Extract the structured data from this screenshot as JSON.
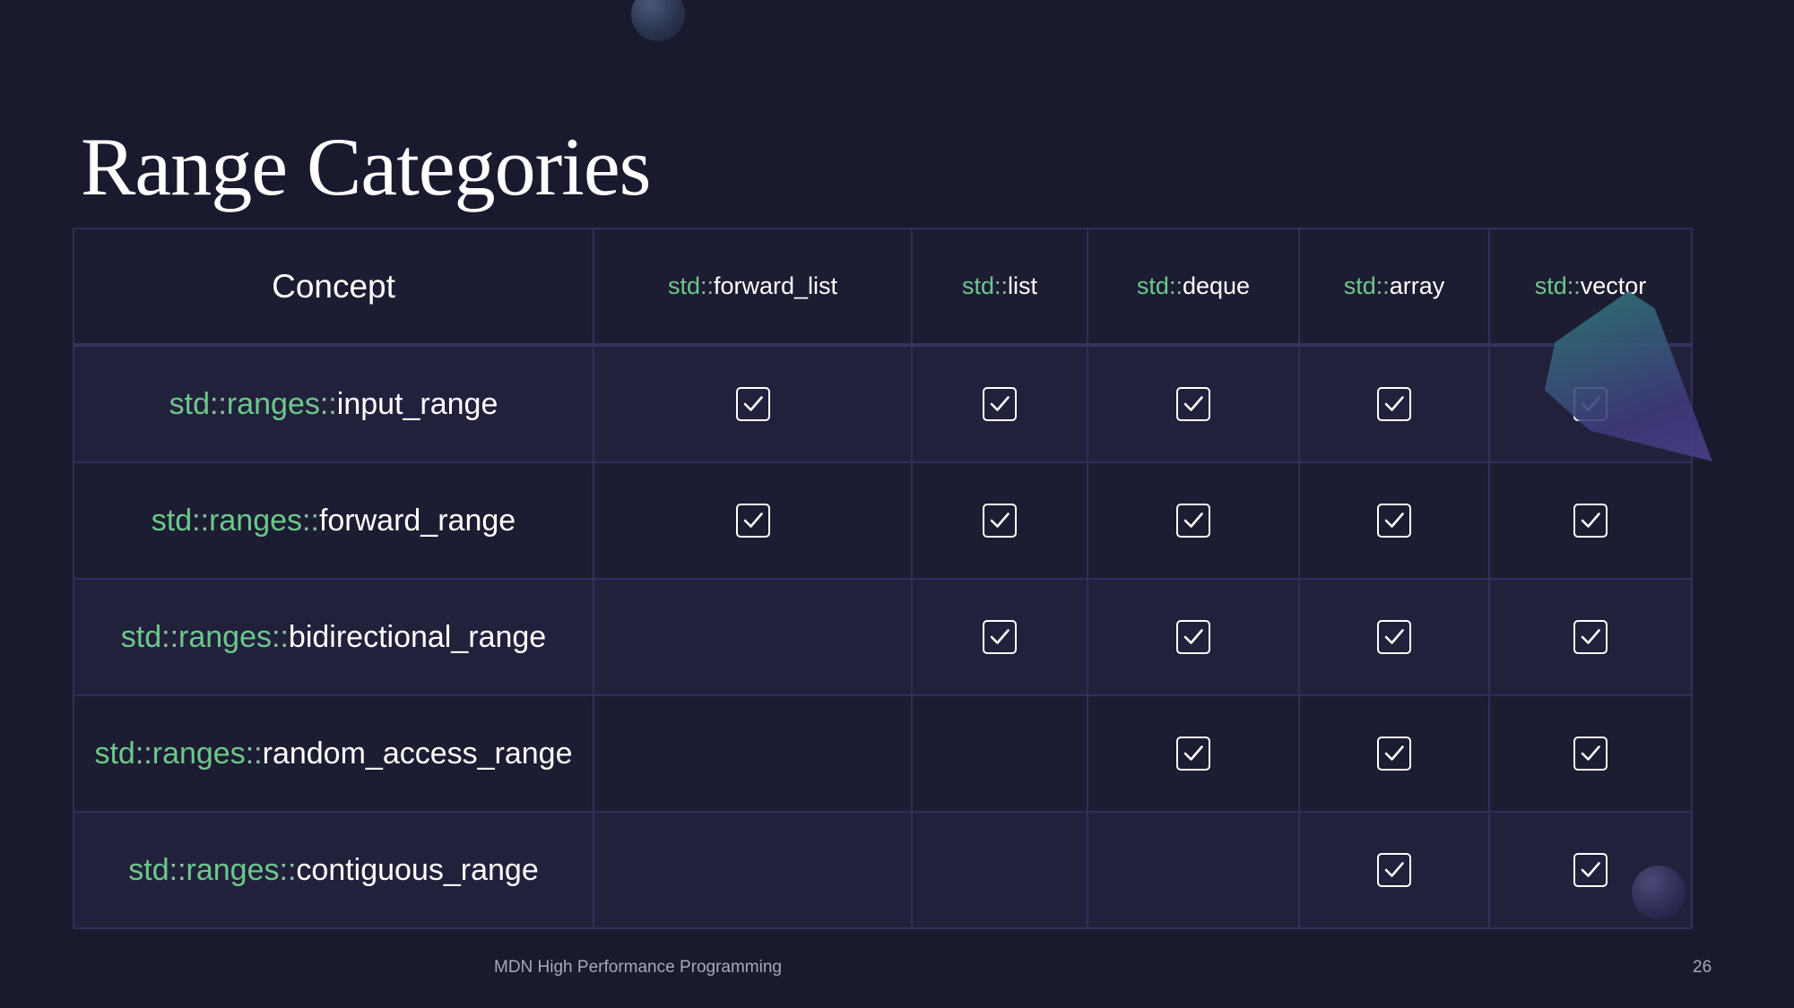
{
  "slide": {
    "title": "Range Categories",
    "footer_text": "MDN High Performance Programming",
    "page_number": "26"
  },
  "table": {
    "concept_header": "Concept",
    "columns": [
      {
        "ns": "std",
        "sep": "::",
        "name": "forward_list"
      },
      {
        "ns": "std",
        "sep": "::",
        "name": "list"
      },
      {
        "ns": "std",
        "sep": "::",
        "name": "deque"
      },
      {
        "ns": "std",
        "sep": "::",
        "name": "array"
      },
      {
        "ns": "std",
        "sep": "::",
        "name": "vector"
      }
    ],
    "rows": [
      {
        "ns1": "std",
        "sep1": "::",
        "ns2": "ranges",
        "sep2": "::",
        "name": "input_range",
        "checks": [
          true,
          true,
          true,
          true,
          true
        ]
      },
      {
        "ns1": "std",
        "sep1": "::",
        "ns2": "ranges",
        "sep2": "::",
        "name": "forward_range",
        "checks": [
          true,
          true,
          true,
          true,
          true
        ]
      },
      {
        "ns1": "std",
        "sep1": "::",
        "ns2": "ranges",
        "sep2": "::",
        "name": "bidirectional_range",
        "checks": [
          false,
          true,
          true,
          true,
          true
        ]
      },
      {
        "ns1": "std",
        "sep1": "::",
        "ns2": "ranges",
        "sep2": "::",
        "name": "random_access_range",
        "checks": [
          false,
          false,
          true,
          true,
          true
        ]
      },
      {
        "ns1": "std",
        "sep1": "::",
        "ns2": "ranges",
        "sep2": "::",
        "name": "contiguous_range",
        "checks": [
          false,
          false,
          false,
          true,
          true
        ]
      }
    ]
  },
  "colors": {
    "background": "#1a1a2e",
    "namespace_green": "#6cc88a",
    "grid_line": "#2f2f5a",
    "footer_gray": "#a8a8b8"
  },
  "icons": {
    "check": "checkbox-checked-icon"
  }
}
